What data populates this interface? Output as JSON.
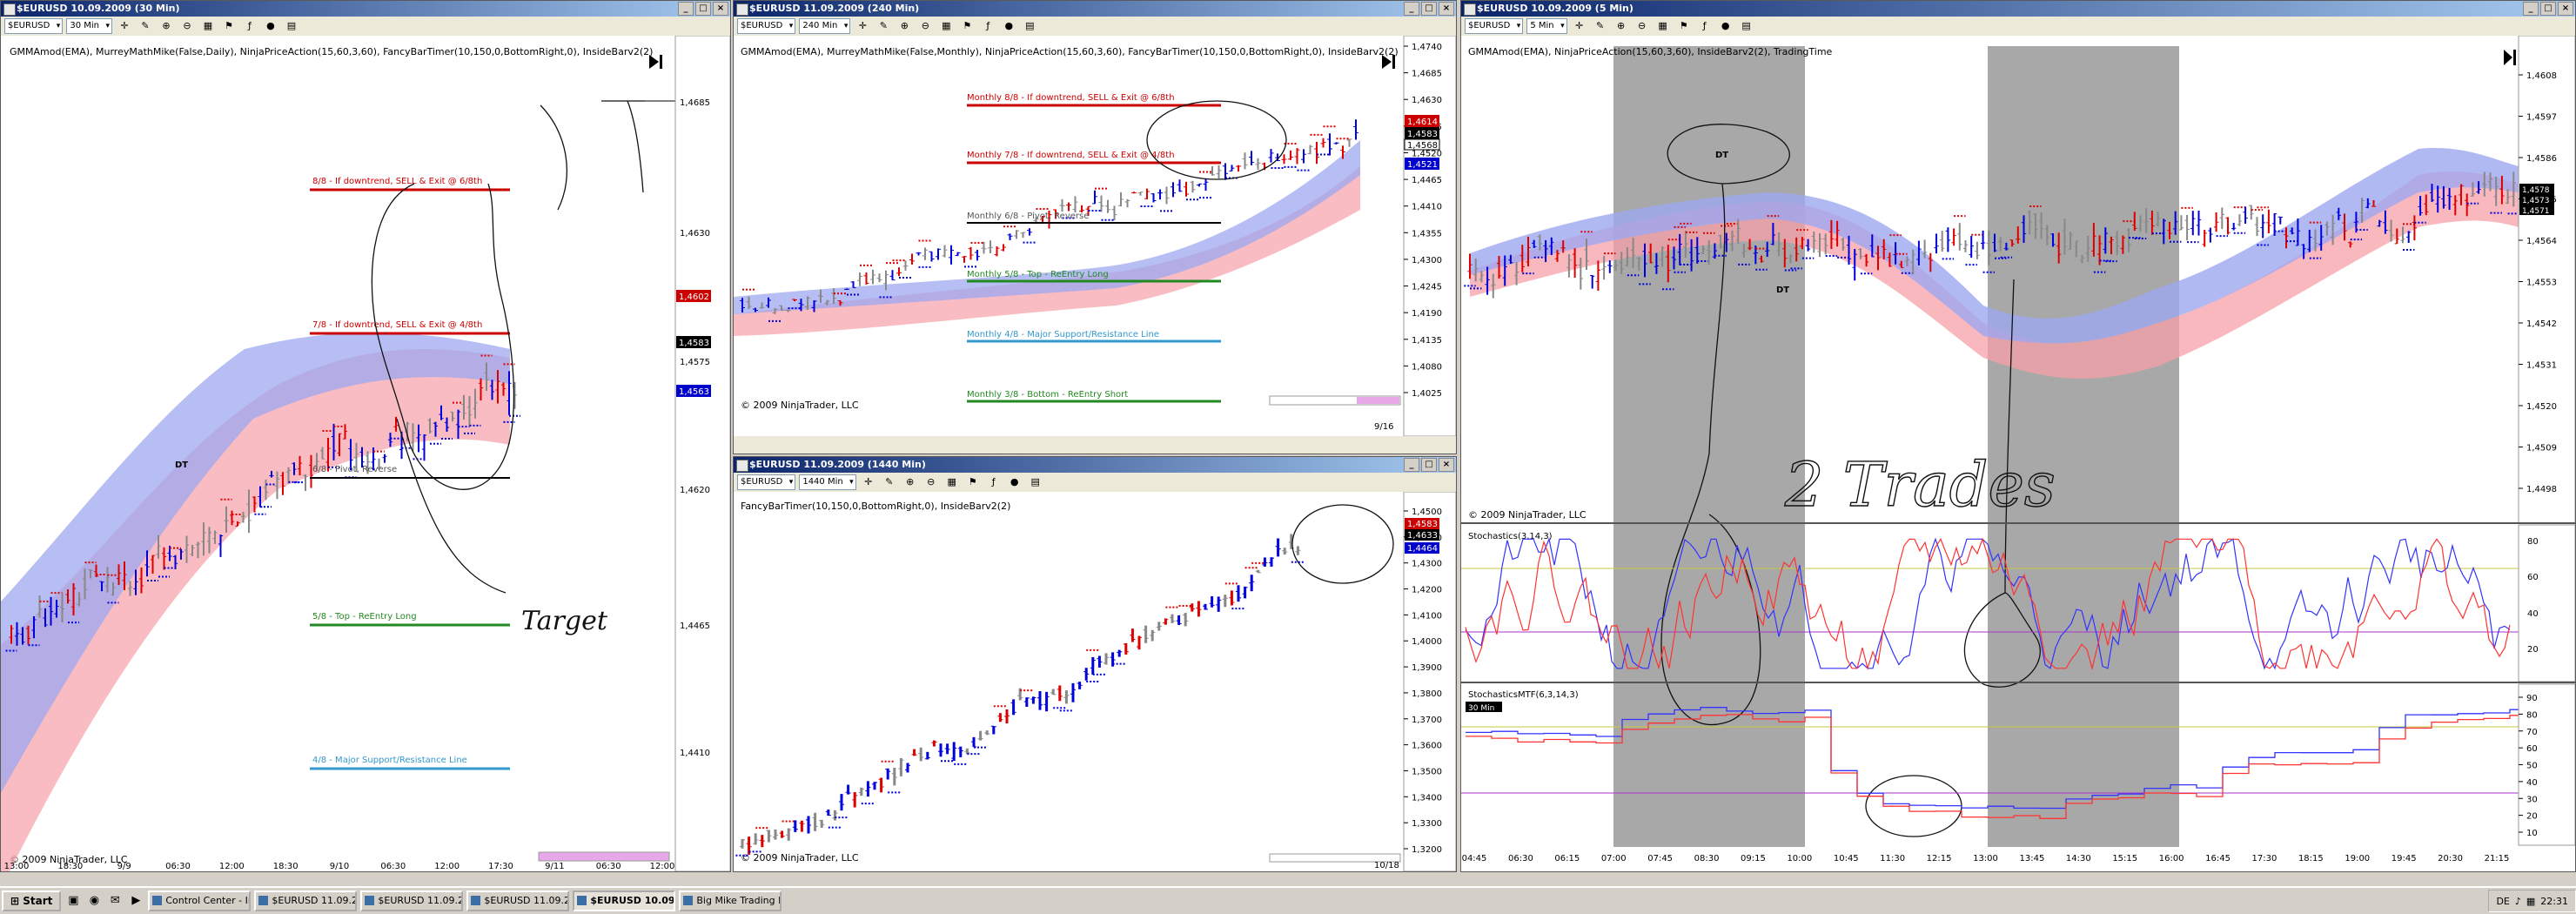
{
  "windows": [
    {
      "title": "$EURUSD  10.09.2009 (30 Min)",
      "symbol": "$EURUSD",
      "interval": "30 Min",
      "indicators": "GMMAmod(EMA), MurreyMathMike(False,Daily), NinjaPriceAction(15,60,3,60), FancyBarTimer(10,150,0,BottomRight,0), InsideBarv2(2)",
      "copyright": "© 2009 NinjaTrader, LLC",
      "price_axis": [
        "1,4685",
        "1,4630",
        "1,4583",
        "1,4575",
        "1,4563",
        "1,4620",
        "1,4465",
        "1,4410"
      ],
      "time_axis": [
        "13:00",
        "18:30",
        "9/9",
        "06:30",
        "12:00",
        "18:30",
        "9/10",
        "06:30",
        "12:00",
        "17:30",
        "9/11",
        "06:30",
        "12:00"
      ],
      "price_labels": [
        {
          "text": "1,4602",
          "color": "#cc0000"
        },
        {
          "text": "1,4583",
          "color": "#000000"
        },
        {
          "text": "1,4563",
          "color": "#0000cc"
        }
      ],
      "levels": [
        {
          "text": "8/8 - If downtrend, SELL & Exit @ 6/8th",
          "color": "#cc0000"
        },
        {
          "text": "7/8 - If downtrend, SELL & Exit @ 4/8th",
          "color": "#cc0000"
        },
        {
          "text": "6/8 - Pivot, Reverse",
          "color": "#000000"
        },
        {
          "text": "5/8 - Top - ReEntry Long",
          "color": "#228822"
        },
        {
          "text": "4/8 - Major Support/Resistance Line",
          "color": "#3399cc"
        }
      ],
      "annotations": [
        "DT",
        "Target"
      ]
    },
    {
      "title": "$EURUSD  11.09.2009 (240 Min)",
      "symbol": "$EURUSD",
      "interval": "240 Min",
      "indicators": "GMMAmod(EMA), MurreyMathMike(False,Monthly), NinjaPriceAction(15,60,3,60), FancyBarTimer(10,150,0,BottomRight,0), InsideBarv2(2)",
      "copyright": "© 2009 NinjaTrader, LLC",
      "price_axis": [
        "1,4740",
        "1,4685",
        "1,4630",
        "1,4575",
        "1,4520",
        "1,4465",
        "1,4410",
        "1,4355",
        "1,4300",
        "1,4245",
        "1,4190",
        "1,4135",
        "1,4080",
        "1,4025"
      ],
      "time_axis": [
        "9/16"
      ],
      "price_labels": [
        {
          "text": "1,4614",
          "color": "#cc0000"
        },
        {
          "text": "1,4583",
          "color": "#000000"
        },
        {
          "text": "1,4568",
          "color": "#000000"
        },
        {
          "text": "1,4521",
          "color": "#0000cc"
        }
      ],
      "levels": [
        {
          "text": "Monthly 8/8 - If downtrend, SELL & Exit @ 6/8th",
          "color": "#cc0000"
        },
        {
          "text": "Monthly 7/8 - If downtrend, SELL & Exit @ 4/8th",
          "color": "#cc0000"
        },
        {
          "text": "Monthly 6/8 - Pivot, Reverse",
          "color": "#000000"
        },
        {
          "text": "Monthly 5/8 - Top - ReEntry Long",
          "color": "#228822"
        },
        {
          "text": "Monthly 4/8 - Major Support/Resistance Line",
          "color": "#3399cc"
        },
        {
          "text": "Monthly 3/8 - Bottom - ReEntry Short",
          "color": "#228822"
        }
      ]
    },
    {
      "title": "$EURUSD  11.09.2009 (1440 Min)",
      "symbol": "$EURUSD",
      "interval": "1440 Min",
      "indicators": "FancyBarTimer(10,150,0,BottomRight,0), InsideBarv2(2)",
      "copyright": "© 2009 NinjaTrader, LLC",
      "price_axis": [
        "1,4500",
        "1,4400",
        "1,4300",
        "1,4200",
        "1,4100",
        "1,4000",
        "1,3900",
        "1,3800",
        "1,3700",
        "1,3600",
        "1,3500",
        "1,3400",
        "1,3300",
        "1,3200"
      ],
      "time_axis": [
        "10/18"
      ],
      "price_labels": [
        {
          "text": "1,4583",
          "color": "#cc0000"
        },
        {
          "text": "1,4633",
          "color": "#000000"
        },
        {
          "text": "1,4464",
          "color": "#0000cc"
        }
      ]
    },
    {
      "title": "$EURUSD  10.09.2009 (5 Min)",
      "symbol": "$EURUSD",
      "interval": "5 Min",
      "indicators": "GMMAmod(EMA), NinjaPriceAction(15,60,3,60), InsideBarv2(2), TradingTime",
      "copyright": "© 2009 NinjaTrader, LLC",
      "price_axis": [
        "1,4608",
        "1,4597",
        "1,4586",
        "1,4575",
        "1,4564",
        "1,4553",
        "1,4542",
        "1,4531",
        "1,4520",
        "1,4509",
        "1,4498"
      ],
      "price_labels": [
        {
          "text": "1,4578",
          "color": "#000000"
        },
        {
          "text": "1,4573",
          "color": "#000000"
        },
        {
          "text": "1,4571",
          "color": "#000000"
        },
        {
          "text": "1,4564",
          "color": "#000000"
        }
      ],
      "time_axis": [
        "04:45",
        "06:30",
        "06:15",
        "07:00",
        "07:45",
        "08:30",
        "09:15",
        "10:00",
        "10:45",
        "11:30",
        "12:15",
        "13:00",
        "13:45",
        "14:30",
        "15:15",
        "16:00",
        "16:45",
        "17:30",
        "18:15",
        "19:00",
        "19:45",
        "20:30",
        "21:15"
      ],
      "stoch_label": "Stochastics(3,14,3)",
      "stoch_axis": [
        "80",
        "60",
        "40",
        "20"
      ],
      "stochmtf_label": "StochasticsMTF(6,3,14,3)",
      "stochmtf_tag": "30 Min",
      "stochmtf_axis": [
        "90",
        "80",
        "70",
        "60",
        "50",
        "40",
        "30",
        "20",
        "10"
      ],
      "annotations": [
        "DT",
        "DT",
        "2 Trades"
      ]
    }
  ],
  "taskbar": {
    "start_label": "Start",
    "tasks": [
      "Control Center - In...",
      "$EURUSD  11.09.2...",
      "$EURUSD  11.09.2...",
      "$EURUSD  11.09.2...",
      "$EURUSD  10.09...",
      "Big Mike Trading Fo..."
    ],
    "active_index": 4,
    "lang": "DE",
    "clock": "22:31"
  }
}
